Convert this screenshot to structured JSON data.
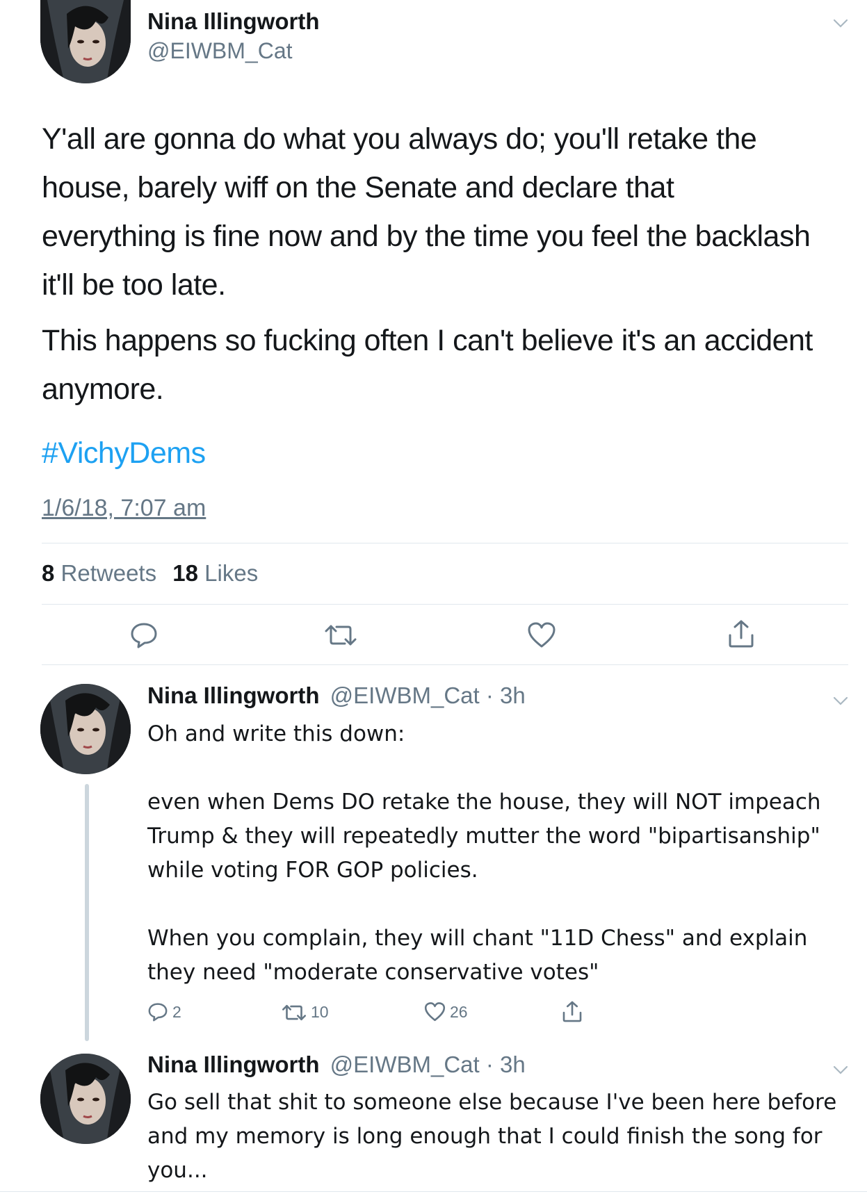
{
  "main_tweet": {
    "author_name": "Nina Illingworth",
    "handle": "@EIWBM_Cat",
    "paragraph_1": "Y'all are gonna do what you always do; you'll retake the house, barely wiff on the Senate and declare that everything is fine now and by the time you feel the backlash it'll be too late.",
    "paragraph_2": "This happens so fucking often I can't believe it's an accident anymore.",
    "hashtag": "#VichyDems",
    "timestamp": "1/6/18, 7:07 am",
    "retweets_count": "8",
    "retweets_label": "Retweets",
    "likes_count": "18",
    "likes_label": "Likes"
  },
  "replies": [
    {
      "author_name": "Nina Illingworth",
      "handle_time": "@EIWBM_Cat · 3h",
      "text": "Oh and write this down:\n\neven when Dems DO retake the house, they will NOT impeach Trump & they will repeatedly mutter the word \"bipartisanship\" while voting FOR GOP policies.\n\nWhen you complain, they will chant \"11D Chess\" and explain they need \"moderate conservative votes\"",
      "reply_count": "2",
      "retweet_count": "10",
      "like_count": "26"
    },
    {
      "author_name": "Nina Illingworth",
      "handle_time": "@EIWBM_Cat · 3h",
      "text": "Go sell that shit to someone else because I've been here before and my memory is long enough that I could finish the song for you..."
    }
  ],
  "colors": {
    "link_blue": "#1da1f2",
    "muted_gray": "#657786",
    "divider": "#e1e8ed",
    "thread_line": "#ccd6dd"
  }
}
